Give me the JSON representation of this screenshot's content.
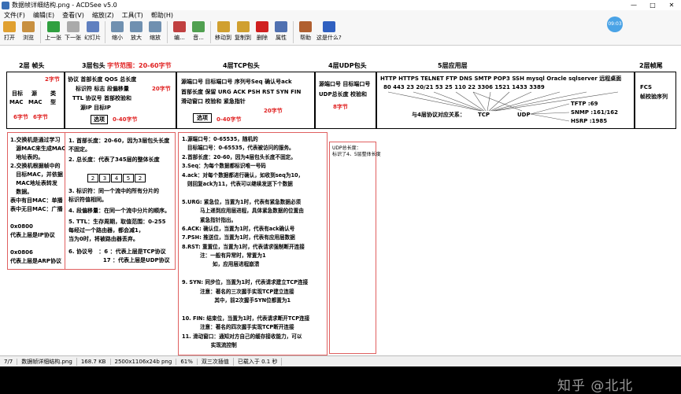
{
  "window": {
    "title": "数据帧详细结构.png - ACDSee v5.0",
    "min": "—",
    "max": "□",
    "close": "✕"
  },
  "menu": [
    "文件(F)",
    "编辑(E)",
    "查看(V)",
    "缩放(Z)",
    "工具(T)",
    "帮助(H)"
  ],
  "toolbar": [
    {
      "label": "打开",
      "icon": "open-folder-icon",
      "color": "#e0a030"
    },
    {
      "label": "浏览",
      "icon": "browse-icon",
      "color": "#c89040"
    },
    {
      "label": "上一张",
      "icon": "prev-image-icon",
      "color": "#30a040"
    },
    {
      "label": "下一张",
      "icon": "next-image-icon",
      "color": "#aaaaaa"
    },
    {
      "label": "幻灯片",
      "icon": "slideshow-icon",
      "color": "#6080c0"
    },
    {
      "label": "缩小",
      "icon": "zoom-out-icon",
      "color": "#7090b0"
    },
    {
      "label": "放大",
      "icon": "zoom-in-icon",
      "color": "#7090b0"
    },
    {
      "label": "缩放",
      "icon": "zoom-icon",
      "color": "#7090b0"
    },
    {
      "label": "编...",
      "icon": "edit-icon",
      "color": "#c04040"
    },
    {
      "label": "音...",
      "icon": "audio-icon",
      "color": "#50a050"
    },
    {
      "label": "移动到",
      "icon": "move-to-icon",
      "color": "#d0a030"
    },
    {
      "label": "复制到",
      "icon": "copy-to-icon",
      "color": "#d0a030"
    },
    {
      "label": "删除",
      "icon": "delete-icon",
      "color": "#d02020"
    },
    {
      "label": "属性",
      "icon": "properties-icon",
      "color": "#5070b0"
    },
    {
      "label": "帮助",
      "icon": "help-icon",
      "color": "#b06030"
    },
    {
      "label": "这是什么?",
      "icon": "whats-this-icon",
      "color": "#3060c0"
    }
  ],
  "badge": "09:03",
  "diagram": {
    "h_l2": "2层 帧头",
    "h_l3": "3层包头",
    "h_l3range": "字节范围：20-60字节",
    "h_tcp": "4层TCP包头",
    "h_udp": "4层UDP包头",
    "h_l5": "5层应用层",
    "h_tail": "2层帧尾",
    "l2": {
      "b2": "2字节",
      "dst": "目标",
      "src": "源",
      "type": "类",
      "mac1": "MAC",
      "mac2": "MAC",
      "type2": "型",
      "b6a": "6字节",
      "b6b": "6字节"
    },
    "l3": {
      "r1": "协议  首部长度   QOS  总长度",
      "r2": "标识符  标志  段偏移量",
      "r3": "TTL  协议号  首部校验和",
      "r4": "源IP   目标IP",
      "b20": "20字节",
      "opt": "选项",
      "optlen": "0-40字节"
    },
    "tcp": {
      "r1": "源端口号  目标端口号   序列号Seq  确认号ack",
      "r2": "首部长度  保留  URG ACK PSH RST SYN  FIN",
      "r3": "滑动窗口   校验和     紧急指针",
      "b20": "20字节",
      "opt": "选项",
      "optlen": "0-40字节"
    },
    "udp": {
      "r1": "源端口号  目标端口号",
      "r2": "UDP总长度  校验和",
      "b8": "8字节"
    },
    "app": {
      "protos": "HTTP  HTTPS  TELNET    FTP   DNS  SMTP  POP3  SSH   mysql    Oracle   sqlserver  远程桌面",
      "ports": "80       443        23        20/21      53     25      110     22    3306     1521      1433         3389",
      "rel": "与4层协议对应关系：",
      "tcp": "TCP",
      "udp": "UDP",
      "tftp": "TFTP  :69",
      "snmp": "SNMP  :161/162",
      "hsrp": "HSRP  :1985"
    },
    "tail": {
      "fcs": "FCS",
      "check": "帧校验序列"
    },
    "l2notes": [
      "1.交换机是通过学习",
      "   源MAC来生成MAC",
      "   地址表的。",
      "2.交换机根据帧中的",
      "   目标MAC，并依据",
      "   MAC地址表转发",
      "   数据。",
      "表中有目MAC：单播",
      "表中无目MAC：广播",
      "",
      "0x0800",
      "代表上层是IP协议",
      "",
      "0x0806",
      "代表上层是ARP协议"
    ],
    "l3notes": {
      "n1": "1. 首部长度：20-60，因为3层包头长度",
      "n1b": "    不固定。",
      "n2": "2. 总长度：代表了345层的整体长度",
      "cells": [
        "2",
        "3",
        "4",
        "5",
        "2"
      ],
      "n3": "3. 标识符：同一个流中的所有分片的",
      "n3b": "    标识符值相同。",
      "n4": "4. 段偏移量：在同一个流中分片的顺序。",
      "n5": "5. TTL：生存周期，取值范围：0-255",
      "n5b": "    每经过一个路由器，都会减1，",
      "n5c": "    当为0时，将被路由器丢弃。",
      "n6": "6. 协议号   ：6 ：代表上层是TCP协议",
      "n6b": "                  17 ：代表上层是UDP协议"
    },
    "tcpnotes": [
      "1.源端口号：0-65535，随机的",
      "   目标端口号：0-65535，代表被访问的服务。",
      "2.首部长度：20-60，因为4层包头长度不固定。",
      "3.Seq：为每个数据都标识唯一号码",
      "4.ack：对每个数据都进行确认，如收到seq为10，",
      "   则回复ack为11，代表可以继续发送下个数据",
      "",
      "5.URG: 紧急位，当置为1时，代表有紧急数据必须",
      "          马上递到应用层进程，具体紧急数据的位置由",
      "          紧急指针指出。",
      "6.ACK: 确认位，当置为1时，代表有ack确认号",
      "7.PSH: 推送位，当置为1时，代表有应用层数据",
      "8.RST: 重置位，当置为1时，代表请求强制断开连接",
      "          注：一般有异常时，常置为1",
      "                 如，应用层进程崩溃",
      "",
      "9. SYN: 同步位，当置为1时，代表请求建立TCP连接",
      "          注意：著名的三次握手实现TCP建立连接",
      "                  其中，前2次握手SYN位都置为1",
      "",
      "10. FIN: 结束位，当置为1时，代表请求断开TCP连接",
      "          注意：著名的四次握手实现TCP断开连接",
      "11. 滑动窗口：通知对方自己的缓存接收能力，可以",
      "                实现流控制"
    ],
    "udpnote": [
      "UDP总长度：",
      "标识了4、5层整体长度"
    ]
  },
  "watermark": "知乎 @北北",
  "status": [
    "7/7",
    "数据帧详细结构.png",
    "168.7 KB",
    "2500x1106x24b png",
    "61%",
    "双三次插值",
    "已载入于 0.1 秒"
  ]
}
